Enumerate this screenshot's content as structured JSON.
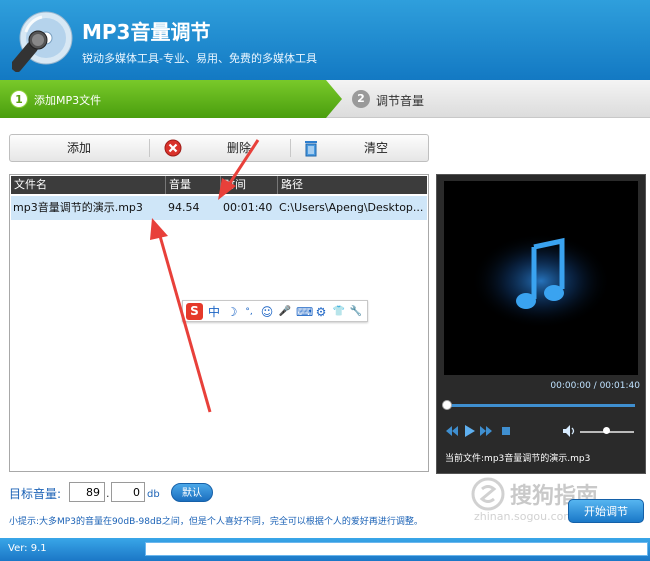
{
  "header": {
    "title": "MP3音量调节",
    "subtitle": "锐动多媒体工具-专业、易用、免费的多媒体工具"
  },
  "steps": [
    {
      "num": "1",
      "label": "添加MP3文件",
      "active": true
    },
    {
      "num": "2",
      "label": "调节音量",
      "active": false
    }
  ],
  "toolbar": {
    "add_label": "添加",
    "delete_label": "删除",
    "clear_label": "清空"
  },
  "filelist": {
    "columns": [
      "文件名",
      "音量",
      "时间",
      "路径"
    ],
    "rows": [
      {
        "name": "mp3音量调节的演示.mp3",
        "volume": "94.54",
        "time": "00:01:40",
        "path": "C:\\Users\\Apeng\\Desktop..."
      }
    ]
  },
  "ime": {
    "logo": "S",
    "items": [
      "中",
      "☽",
      "°,",
      "☺",
      "🎤",
      "⌨",
      "⚙",
      "👕",
      "🔧"
    ]
  },
  "player": {
    "time": "00:00:00 / 00:01:40",
    "progress": 0,
    "volume": 0.45,
    "current_prefix": "当前文件:",
    "current_file": "mp3音量调节的演示.mp3"
  },
  "target": {
    "label": "目标音量:",
    "int_value": "89",
    "dec_value": "0",
    "unit": "db",
    "default_label": "默认"
  },
  "hint": "小提示:大多MP3的音量在90dB-98dB之间，但是个人喜好不同，完全可以根据个人的爱好再进行调整。",
  "start_label": "开始调节",
  "watermark": {
    "text": "搜狗指南",
    "url_text": "zhinan.sogou.com"
  },
  "status": {
    "version": "Ver: 9.1"
  },
  "colors": {
    "accent": "#1b77c6",
    "step_active": "#5fb51a",
    "selected_row": "#cfe6f8",
    "arrow": "#e8403a"
  }
}
